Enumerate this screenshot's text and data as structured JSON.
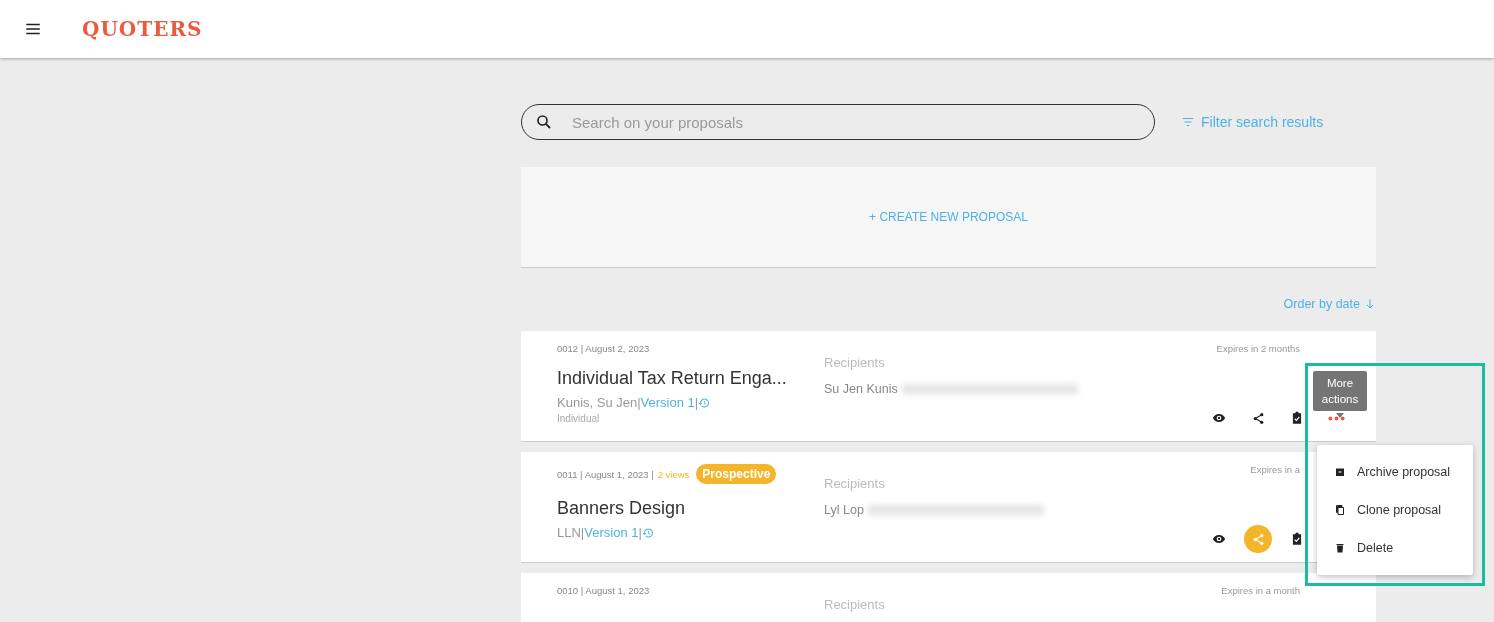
{
  "header": {
    "logo": "QUOTERS"
  },
  "search": {
    "placeholder": "Search on your proposals"
  },
  "filter_link": "Filter search results",
  "create_button": "+ CREATE NEW PROPOSAL",
  "order_link": "Order by date",
  "proposals": [
    {
      "meta": "0012 | August 2, 2023",
      "title": "Individual Tax Return Enga...",
      "client": "Kunis, Su Jen",
      "separators": [
        "|",
        "|"
      ],
      "version": "Version 1",
      "type": "Individual",
      "recipients_label": "Recipients",
      "recipient": "Su Jen Kunis",
      "expires": "Expires in 2 months",
      "shared": false,
      "menu_open": true
    },
    {
      "meta": "0011 | August 1, 2023 |",
      "views": "2 views",
      "badge": "Prospective",
      "title": "Banners Design",
      "client": "LLN",
      "separators": [
        "|",
        "|"
      ],
      "version": "Version 1",
      "recipients_label": "Recipients",
      "recipient": "Lyl Lop",
      "expires": "Expires in a",
      "shared": true,
      "menu_open": false
    },
    {
      "meta": "0010 | August 1, 2023",
      "recipients_label": "Recipients",
      "expires": "Expires in a month"
    }
  ],
  "tooltip": "More actions",
  "menu": [
    {
      "kind": "archive",
      "label": "Archive proposal"
    },
    {
      "kind": "clone",
      "label": "Clone proposal"
    },
    {
      "kind": "delete",
      "label": "Delete"
    }
  ],
  "highlight": true
}
